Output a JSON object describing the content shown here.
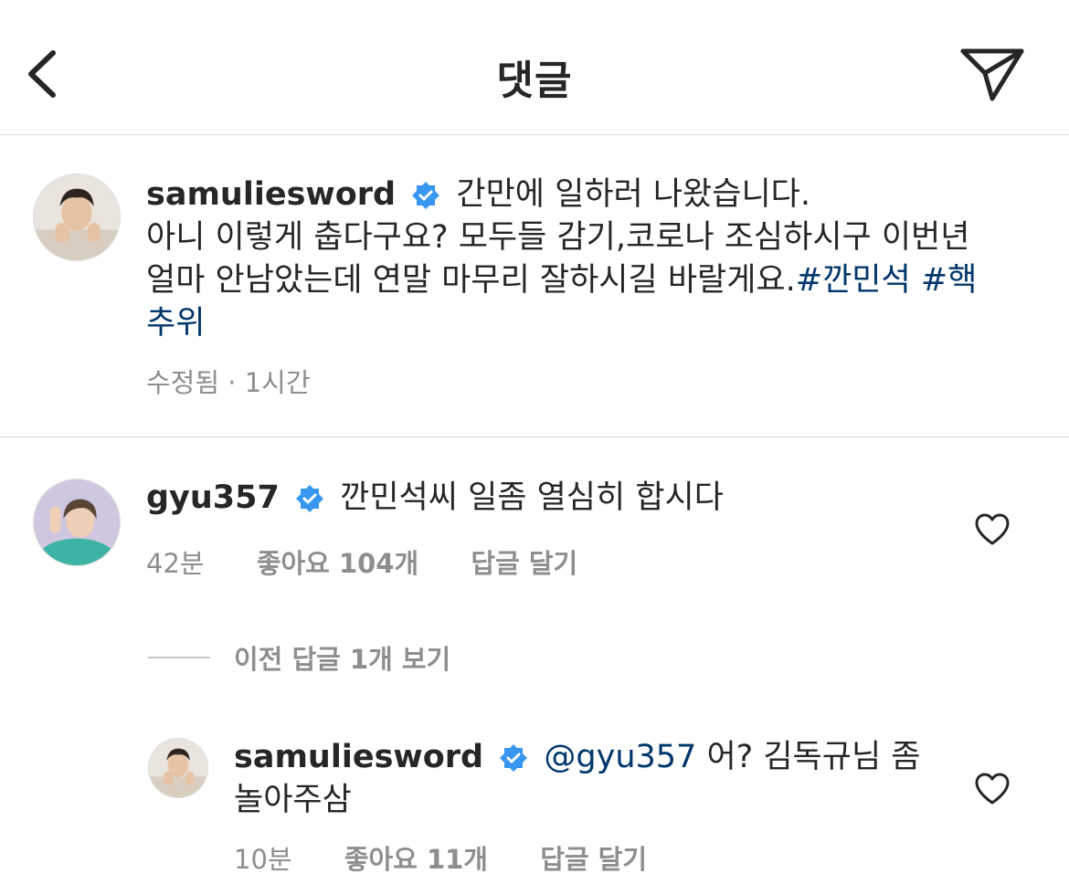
{
  "header": {
    "title": "댓글",
    "back_icon": "chevron-left-icon",
    "share_icon": "paper-plane-icon"
  },
  "caption": {
    "username": "samuliesword",
    "verified_icon": "verified-badge-icon",
    "text_line1": "간만에 일하러 나왔습니다.",
    "text_line2": "아니 이렇게 춥다구요? 모두들 감기,코로나 조심하시구 이번년",
    "text_line3": "얼마 안남았는데 연말 마무리 잘하시길 바랄게요.",
    "hashtag1": "#깐민석",
    "hashtag2_part1": "#핵",
    "hashtag2_part2": "추위",
    "meta": "수정됨 · 1시간"
  },
  "comments": [
    {
      "username": "gyu357",
      "text": "깐민석씨 일좀 열심히 합시다",
      "time": "42분",
      "likes": "좋아요 104개",
      "reply": "답글 달기",
      "heart_icon": "heart-outline-icon"
    }
  ],
  "view_replies": "이전 답글 1개 보기",
  "reply": {
    "username": "samuliesword",
    "mention": "@gyu357",
    "text_line1": "어? 김독규님 좀",
    "text_line2": "놀아주삼",
    "time": "10분",
    "likes": "좋아요 11개",
    "reply": "답글 달기",
    "heart_icon": "heart-outline-icon"
  },
  "colors": {
    "text": "#262626",
    "secondary": "#8e8e8e",
    "link": "#00376b",
    "verified": "#3897f0",
    "divider": "#dbdbdb"
  }
}
